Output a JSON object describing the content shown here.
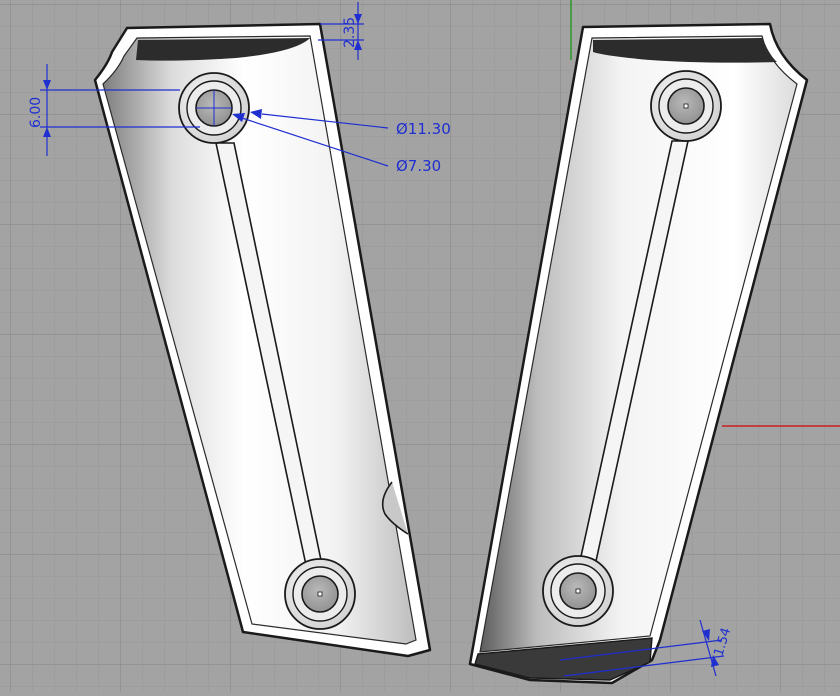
{
  "viewport": {
    "background": "#a3a3a3",
    "grid_minor_color": "#9a9a9a",
    "grid_major_color": "#8e8e8e",
    "axis_x_color": "#c82020",
    "axis_y_color": "#2a9a2a"
  },
  "dimension_color": "#1f2fd0",
  "dimensions": {
    "top_thickness": "2.35",
    "hole_offset": "6.00",
    "outer_diameter": "Ø11.30",
    "inner_diameter": "Ø7.30",
    "bottom_thickness": "1.54"
  },
  "parts": {
    "left": {
      "name": "left grip panel"
    },
    "right": {
      "name": "right grip panel"
    }
  }
}
